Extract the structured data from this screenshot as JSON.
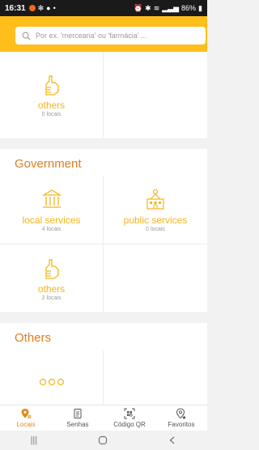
{
  "status_bar": {
    "time": "16:31",
    "battery": "86%"
  },
  "search": {
    "placeholder": "Por ex. 'mercearia' ou 'farmácia' ..."
  },
  "sections": [
    {
      "title": "",
      "tiles": [
        {
          "name": "others",
          "count": "0 locais",
          "icon": "hand-icon"
        }
      ]
    },
    {
      "title": "Government",
      "tiles": [
        {
          "name": "local services",
          "count": "4 locais",
          "icon": "building-columns-icon"
        },
        {
          "name": "public services",
          "count": "0 locais",
          "icon": "public-building-icon"
        },
        {
          "name": "others",
          "count": "2 locais",
          "icon": "hand-icon"
        }
      ]
    },
    {
      "title": "Others",
      "tiles": [
        {
          "name": "",
          "count": "",
          "icon": "dots-icon"
        }
      ]
    }
  ],
  "bottom_nav": [
    {
      "label": "Locais",
      "icon": "location-icon",
      "active": true
    },
    {
      "label": "Senhas",
      "icon": "ticket-icon",
      "active": false
    },
    {
      "label": "Código QR",
      "icon": "qr-code-icon",
      "active": false
    },
    {
      "label": "Favoritos",
      "icon": "favorite-location-icon",
      "active": false
    }
  ],
  "colors": {
    "accent": "#ffbe1a",
    "section_title": "#e17c1e",
    "tile_text": "#f2b51a",
    "active_nav": "#e08a17"
  }
}
